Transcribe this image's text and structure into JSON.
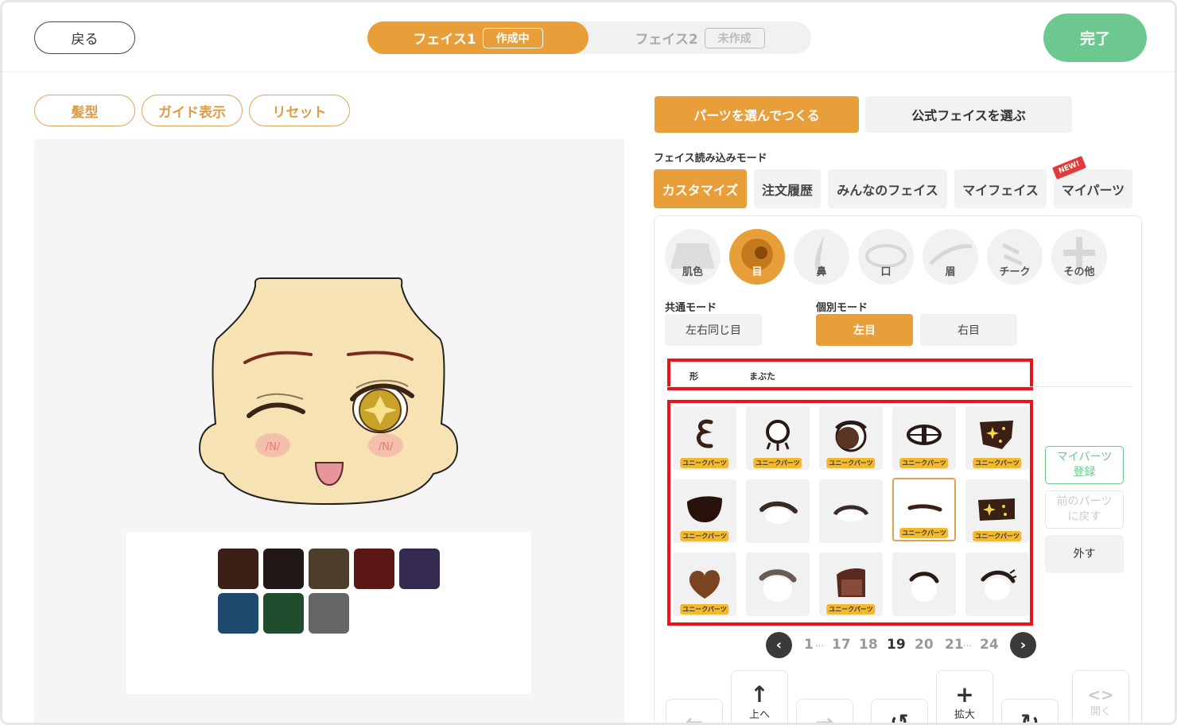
{
  "header": {
    "back_label": "戻る",
    "face1_label": "フェイス1",
    "face1_status": "作成中",
    "face2_label": "フェイス2",
    "face2_status": "未作成",
    "done_label": "完了"
  },
  "left_tools": {
    "hairstyle": "髪型",
    "guide": "ガイド表示",
    "reset": "リセット"
  },
  "palette": {
    "colors": [
      "#3b1f17",
      "#211817",
      "#4d3d2b",
      "#5b1616",
      "#34294f",
      "#1c496d",
      "#1f4e2e",
      "#666666"
    ]
  },
  "right_modes": {
    "build_parts": "パーツを選んでつくる",
    "official_face": "公式フェイスを選ぶ"
  },
  "load_mode": {
    "title": "フェイス読み込みモード",
    "tabs": [
      "カスタマイズ",
      "注文履歴",
      "みんなのフェイス",
      "マイフェイス",
      "マイパーツ"
    ],
    "new_badge": "NEW!"
  },
  "categories": [
    "肌色",
    "目",
    "鼻",
    "口",
    "眉",
    "チーク",
    "その他"
  ],
  "eye_mode": {
    "common_title": "共通モード",
    "common_btn": "左右同じ目",
    "individual_title": "個別モード",
    "left_eye": "左目",
    "right_eye": "右目"
  },
  "sub_tabs": [
    "形",
    "まぶた"
  ],
  "unique_badge": "ユニークパーツ",
  "side_buttons": {
    "register": "マイパーツ\n登録",
    "undo": "前のパーツ\nに戻す",
    "remove": "外す"
  },
  "pagination": {
    "pages": [
      "1",
      "…",
      "17",
      "18",
      "19",
      "20",
      "21",
      "…",
      "24"
    ],
    "current": "19"
  },
  "controls": {
    "up": "上へ",
    "zoom": "拡大",
    "open": "開く"
  },
  "colors": {
    "accent": "#e89f3a",
    "done": "#6cc88f",
    "highlight": "#e8141e"
  }
}
